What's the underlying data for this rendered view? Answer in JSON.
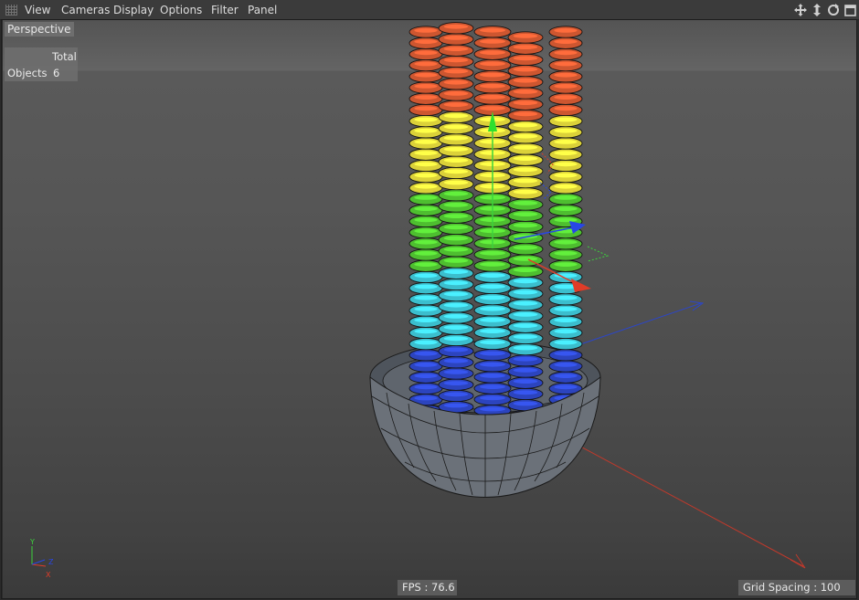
{
  "menubar": {
    "items": [
      "View",
      "Cameras",
      "Display",
      "Options",
      "Filter",
      "Panel"
    ],
    "nav_icons": [
      "move-view-icon",
      "dolly-view-icon",
      "rotate-view-icon",
      "maximize-view-icon"
    ]
  },
  "viewport": {
    "camera": "Perspective",
    "hud": {
      "header": "Total",
      "row_label": "Objects",
      "row_value": "6"
    },
    "fps": "FPS : 76.6",
    "grid_spacing": "Grid Spacing : 100 cm"
  },
  "colors": {
    "rings": [
      "#2e48c8",
      "#3ec8d8",
      "#52c832",
      "#e6dc3c",
      "#d85a32"
    ],
    "axis_x": "#e03c28",
    "axis_y": "#3cd23c",
    "axis_z": "#2846e6"
  }
}
